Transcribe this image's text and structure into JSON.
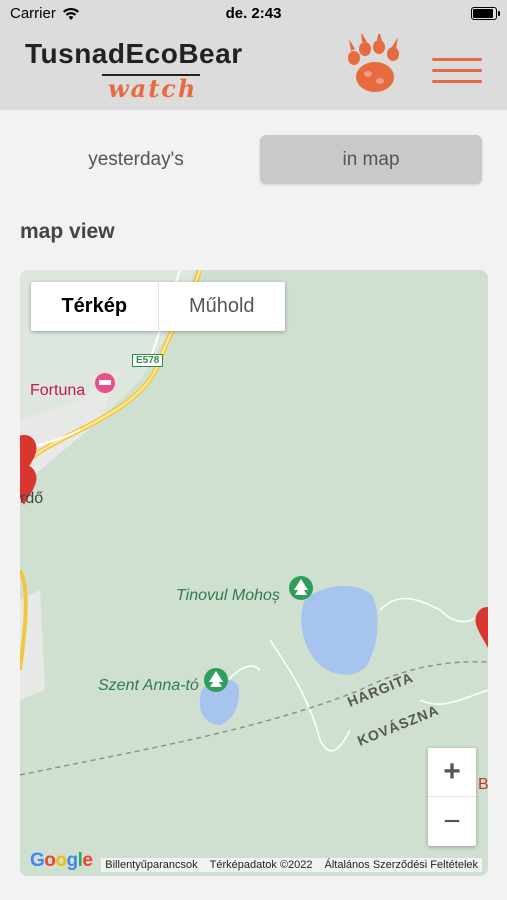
{
  "status": {
    "carrier": "Carrier",
    "time": "de. 2:43",
    "battery_level": 0.95
  },
  "header": {
    "title": "TusnadEcoBear",
    "subtitle": "watch"
  },
  "tabs": [
    {
      "label": "yesterday's",
      "selected": false
    },
    {
      "label": "in map",
      "selected": true
    }
  ],
  "section": {
    "title": "map view"
  },
  "map": {
    "type_control": {
      "map_label": "Térkép",
      "satellite_label": "Műhold",
      "selected": "Térkép"
    },
    "road_shield": "E578",
    "places": {
      "fortuna": "Fortuna",
      "furdo": "rdő",
      "mohos": "Tinovul Mohoș",
      "anna": "Szent Anna-tó",
      "edge_letter": "B"
    },
    "regions": {
      "hargita": "HARGITA",
      "kovaszna": "KOVÁSZNA"
    },
    "zoom": {
      "in": "+",
      "out": "−"
    },
    "footer": {
      "google": "Google",
      "shortcuts": "Billentyűparancsok",
      "mapdata": "Térképadatok ©2022",
      "terms": "Általános Szerződési Feltételek"
    },
    "colors": {
      "water": "#a7c4ef",
      "land": "#cfe0d0",
      "marker": "#d9362f",
      "road": "#f5c542",
      "accent": "#e86a3f"
    }
  }
}
